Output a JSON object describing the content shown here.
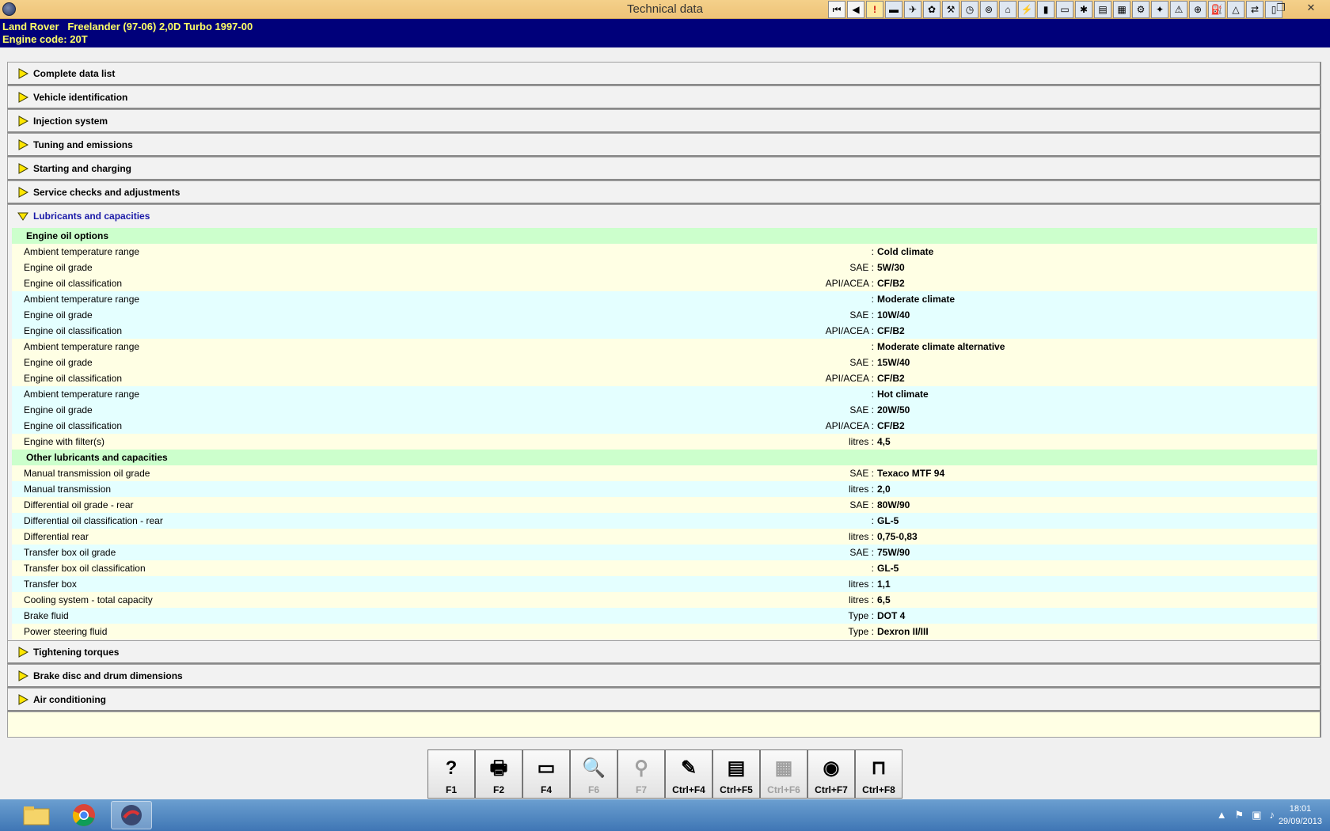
{
  "window": {
    "title": "Technical data"
  },
  "toolbar_icons": [
    "first-page-icon",
    "previous-icon",
    "warning-icon",
    "flag-icon",
    "vehicle-icon",
    "engine-icon",
    "wrench-icon",
    "clock-icon",
    "gauge-icon",
    "garage-icon",
    "sensor-icon",
    "battery-icon",
    "car-icon",
    "crash-icon",
    "bus-icon",
    "calc-icon",
    "tools-icon",
    "lightbulb-icon",
    "hazard-icon",
    "filter-icon",
    "fuel-icon",
    "triangle-icon",
    "tow-icon",
    "notes-icon"
  ],
  "vehicle": {
    "line1": "Land Rover   Freelander (97-06) 2,0D Turbo 1997-00",
    "line2": "Engine code: 20T"
  },
  "sections_top": [
    "Complete data list",
    "Vehicle identification",
    "Injection system",
    "Tuning and emissions",
    "Starting and charging",
    "Service checks and adjustments"
  ],
  "open_section": "Lubricants and capacities",
  "groups": [
    {
      "title": "Engine oil options",
      "rows": [
        {
          "label": "Ambient temperature range",
          "unit": ":",
          "value": "Cold climate",
          "shade": "cold"
        },
        {
          "label": "Engine oil grade",
          "unit": "SAE :",
          "value": "5W/30",
          "shade": "cold"
        },
        {
          "label": "Engine oil classification",
          "unit": "API/ACEA :",
          "value": "CF/B2",
          "shade": "cold"
        },
        {
          "label": "Ambient temperature range",
          "unit": ":",
          "value": "Moderate climate",
          "shade": "blue"
        },
        {
          "label": "Engine oil grade",
          "unit": "SAE :",
          "value": "10W/40",
          "shade": "blue"
        },
        {
          "label": "Engine oil classification",
          "unit": "API/ACEA :",
          "value": "CF/B2",
          "shade": "blue"
        },
        {
          "label": "Ambient temperature range",
          "unit": ":",
          "value": "Moderate climate alternative",
          "shade": "cold"
        },
        {
          "label": "Engine oil grade",
          "unit": "SAE :",
          "value": "15W/40",
          "shade": "cold"
        },
        {
          "label": "Engine oil classification",
          "unit": "API/ACEA :",
          "value": "CF/B2",
          "shade": "cold"
        },
        {
          "label": "Ambient temperature range",
          "unit": ":",
          "value": "Hot climate",
          "shade": "blue"
        },
        {
          "label": "Engine oil grade",
          "unit": "SAE :",
          "value": "20W/50",
          "shade": "blue"
        },
        {
          "label": "Engine oil classification",
          "unit": "API/ACEA :",
          "value": "CF/B2",
          "shade": "blue"
        },
        {
          "label": "Engine with filter(s)",
          "unit": "litres :",
          "value": "4,5",
          "shade": "cold"
        }
      ]
    },
    {
      "title": "Other lubricants and capacities",
      "rows": [
        {
          "label": "Manual transmission oil grade",
          "unit": "SAE :",
          "value": "Texaco MTF 94",
          "shade": "cold"
        },
        {
          "label": "Manual transmission",
          "unit": "litres :",
          "value": "2,0",
          "shade": "blue"
        },
        {
          "label": "Differential oil grade - rear",
          "unit": "SAE :",
          "value": "80W/90",
          "shade": "cold"
        },
        {
          "label": "Differential oil classification - rear",
          "unit": ":",
          "value": "GL-5",
          "shade": "blue"
        },
        {
          "label": "Differential rear",
          "unit": "litres :",
          "value": "0,75-0,83",
          "shade": "cold"
        },
        {
          "label": "Transfer box oil grade",
          "unit": "SAE :",
          "value": "75W/90",
          "shade": "blue"
        },
        {
          "label": "Transfer box oil classification",
          "unit": ":",
          "value": "GL-5",
          "shade": "cold"
        },
        {
          "label": "Transfer box",
          "unit": "litres :",
          "value": "1,1",
          "shade": "blue"
        },
        {
          "label": "Cooling system - total capacity",
          "unit": "litres :",
          "value": "6,5",
          "shade": "cold"
        },
        {
          "label": "Brake fluid",
          "unit": "Type :",
          "value": "DOT 4",
          "shade": "blue"
        },
        {
          "label": "Power steering fluid",
          "unit": "Type :",
          "value": "Dexron II/III",
          "shade": "cold"
        }
      ]
    }
  ],
  "sections_bottom": [
    "Tightening torques",
    "Brake disc and drum dimensions",
    "Air conditioning"
  ],
  "fkeys": [
    {
      "label": "F1",
      "icon": "help-icon",
      "glyph": "?",
      "enabled": true
    },
    {
      "label": "F2",
      "icon": "printer-icon",
      "glyph": "🖶",
      "enabled": true
    },
    {
      "label": "F4",
      "icon": "monitor-icon",
      "glyph": "▭",
      "enabled": true
    },
    {
      "label": "F6",
      "icon": "abc-search-icon",
      "glyph": "🔍",
      "enabled": false
    },
    {
      "label": "F7",
      "icon": "zoom-icon",
      "glyph": "⚲",
      "enabled": false
    },
    {
      "label": "Ctrl+F4",
      "icon": "edit-document-icon",
      "glyph": "✎",
      "enabled": true
    },
    {
      "label": "Ctrl+F5",
      "icon": "notepad-icon",
      "glyph": "▤",
      "enabled": true
    },
    {
      "label": "Ctrl+F6",
      "icon": "calculator-icon",
      "glyph": "▦",
      "enabled": false
    },
    {
      "label": "Ctrl+F7",
      "icon": "wheel-info-icon",
      "glyph": "◉",
      "enabled": true
    },
    {
      "label": "Ctrl+F8",
      "icon": "lift-icon",
      "glyph": "⊓",
      "enabled": true
    }
  ],
  "taskbar": {
    "time": "18:01",
    "date": "29/09/2013"
  }
}
